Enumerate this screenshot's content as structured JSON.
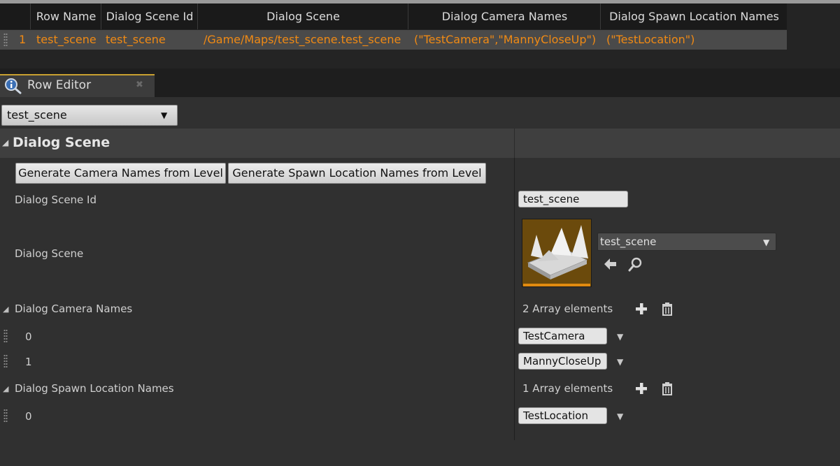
{
  "table": {
    "headers": [
      "Row Name",
      "Dialog Scene Id",
      "Dialog Scene",
      "Dialog Camera Names",
      "Dialog Spawn Location Names"
    ],
    "row": {
      "index": "1",
      "row_name": "test_scene",
      "dialog_scene_id": "test_scene",
      "dialog_scene": "/Game/Maps/test_scene.test_scene",
      "camera_names": "(\"TestCamera\",\"MannyCloseUp\")",
      "spawn_location_names": "(\"TestLocation\")"
    }
  },
  "tab": {
    "title": "Row Editor",
    "close_glyph": "✖"
  },
  "row_selector": {
    "value": "test_scene",
    "arrow": "▼"
  },
  "details": {
    "category_title": "Dialog Scene",
    "caret": "◢",
    "buttons": {
      "generate_camera": "Generate Camera Names from Level",
      "generate_spawn": "Generate Spawn Location Names from Level"
    },
    "scene_id": {
      "label": "Dialog Scene Id",
      "value": "test_scene"
    },
    "scene": {
      "label": "Dialog Scene",
      "asset_value": "test_scene",
      "arrow": "▼"
    },
    "camera_names": {
      "label": "Dialog Camera Names",
      "count_text": "2 Array elements",
      "elements": [
        {
          "index": "0",
          "value": "TestCamera"
        },
        {
          "index": "1",
          "value": "MannyCloseUp"
        }
      ]
    },
    "spawn_names": {
      "label": "Dialog Spawn Location Names",
      "count_text": "1 Array elements",
      "elements": [
        {
          "index": "0",
          "value": "TestLocation"
        }
      ]
    },
    "element_arrow": "▼"
  },
  "icons": {
    "tab": "row-editor-magnifier-info-icon",
    "browse_back": "arrow-left-icon",
    "find": "search-icon",
    "add": "plus-icon",
    "delete": "trash-icon",
    "grip": "drag-grip-icon",
    "asset_thumbnail": "level-map-thumbnail-icon"
  },
  "colors": {
    "accent_orange": "#f08a14",
    "tab_highlight": "#c8a030",
    "panel_bg": "#303030"
  }
}
